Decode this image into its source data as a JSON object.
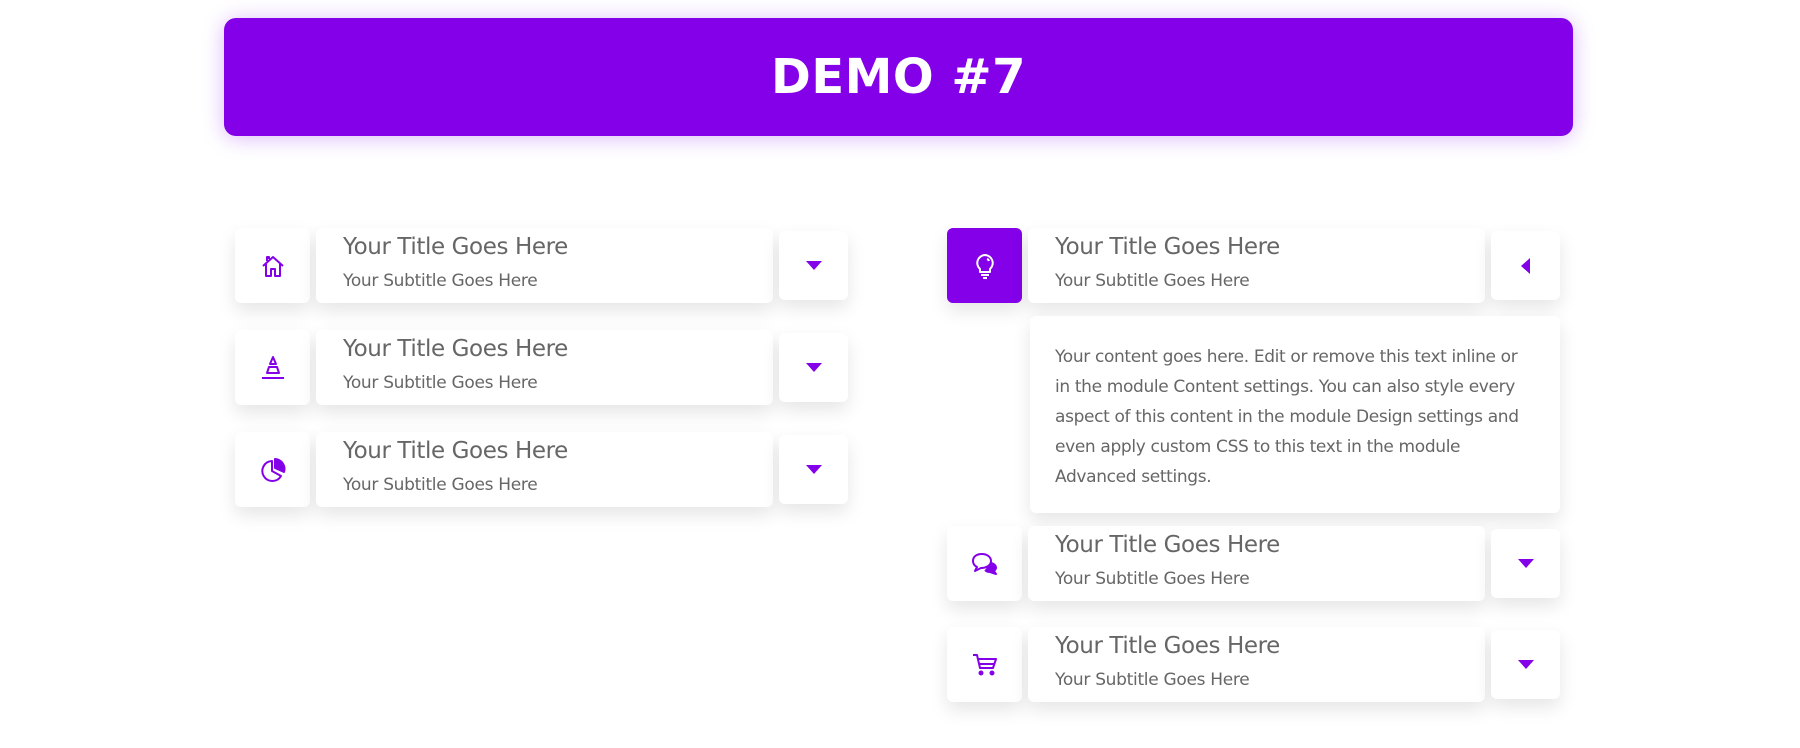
{
  "banner": {
    "title": "DEMO #7"
  },
  "accent_color": "#8300e9",
  "left_column": {
    "items": [
      {
        "icon": "home-icon",
        "title": "Your Title Goes Here",
        "subtitle": "Your Subtitle Goes Here",
        "expanded": false
      },
      {
        "icon": "traffic-cone-icon",
        "title": "Your Title Goes Here",
        "subtitle": "Your Subtitle Goes Here",
        "expanded": false
      },
      {
        "icon": "pie-chart-icon",
        "title": "Your Title Goes Here",
        "subtitle": "Your Subtitle Goes Here",
        "expanded": false
      }
    ]
  },
  "right_column": {
    "items": [
      {
        "icon": "lightbulb-icon",
        "title": "Your Title Goes Here",
        "subtitle": "Your Subtitle Goes Here",
        "expanded": true,
        "content": "Your content goes here. Edit or remove this text inline or in the module Content settings. You can also style every aspect of this content in the module Design settings and even apply custom CSS to this text in the module Advanced settings."
      },
      {
        "icon": "chat-bubbles-icon",
        "title": "Your Title Goes Here",
        "subtitle": "Your Subtitle Goes Here",
        "expanded": false
      },
      {
        "icon": "shopping-cart-icon",
        "title": "Your Title Goes Here",
        "subtitle": "Your Subtitle Goes Here",
        "expanded": false
      }
    ]
  }
}
